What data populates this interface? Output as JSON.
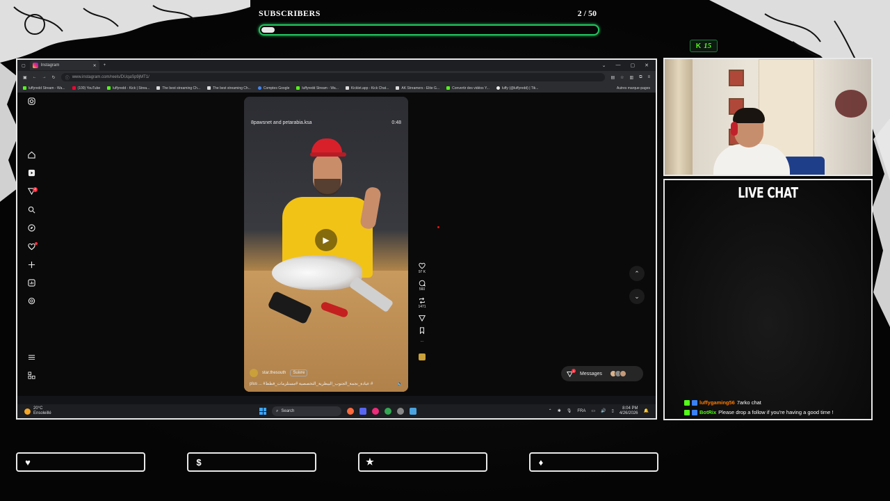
{
  "overlay": {
    "subscribers": {
      "title": "SUBSCRIBERS",
      "count": "2 / 50",
      "progress": 0.04
    },
    "kick_badge": {
      "value": "15"
    },
    "chat": {
      "title": "LIVE CHAT",
      "messages": [
        {
          "user": "luffygaming56",
          "text": "7arko chat"
        },
        {
          "user": "BotRix",
          "text": "Please drop a follow if you're having a good time !"
        }
      ]
    },
    "socials": [
      {
        "icon": "heart-icon",
        "glyph": "♥",
        "text": ""
      },
      {
        "icon": "dollar-icon",
        "glyph": "$",
        "text": ""
      },
      {
        "icon": "star-icon",
        "glyph": "★",
        "text": ""
      },
      {
        "icon": "drop-icon",
        "glyph": "♦",
        "text": ""
      }
    ]
  },
  "browser": {
    "tab_title": "Instagram",
    "url": "www.instagram.com/reels/DUqaSp9jMT1/",
    "bookmarks": [
      {
        "label": "luffyredd Stream - Wa...",
        "icon": "kick"
      },
      {
        "label": "(100) YouTube",
        "icon": "yt"
      },
      {
        "label": "luffyredd - Kick | Strea...",
        "icon": "kick"
      },
      {
        "label": "The best streaming Ch...",
        "icon": "w"
      },
      {
        "label": "The best streaming Ch...",
        "icon": "w"
      },
      {
        "label": "Comptes Google",
        "icon": "g"
      },
      {
        "label": "luffyredd Stream - Wa...",
        "icon": "kick"
      },
      {
        "label": "Kicklet.app - Kick Chat...",
        "icon": "w"
      },
      {
        "label": "AK Streamers - Elite G...",
        "icon": "w"
      },
      {
        "label": "Convertir des vidéos Y...",
        "icon": "kick"
      },
      {
        "label": "luffy (@luffyredd) | Tik...",
        "icon": "tt"
      }
    ],
    "bookmarks_other": "Autres marque-pages"
  },
  "instagram": {
    "notif_count": "4",
    "reel": {
      "collab": "8pawsnet and petarabia.ksa",
      "duration": "0:48",
      "author": "star.thesouth",
      "follow_label": "Suivre",
      "caption": "#عيادة_نجمة_الجنوب_البيطرية_التخصصية #مستلزمات_قطط #",
      "more_label": "plus ...",
      "likes": "97 K",
      "comments": "560",
      "reposts": "1471"
    },
    "messages_label": "Messages",
    "messages_badge": "9"
  },
  "taskbar": {
    "temp": "20°C",
    "weather": "Ensoleillé",
    "search_placeholder": "Search",
    "lang": "FRA",
    "time": "8:04 PM",
    "date": "4/26/2026"
  },
  "colors": {
    "accent_green": "#22c55e",
    "kick_green": "#53fc18",
    "ig_red": "#ff3040"
  }
}
